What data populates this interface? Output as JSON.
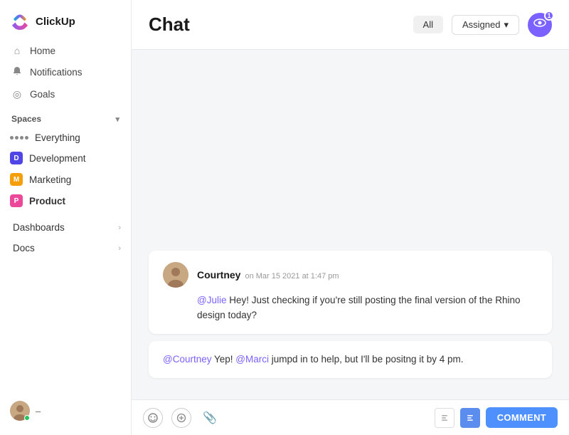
{
  "app": {
    "name": "ClickUp"
  },
  "sidebar": {
    "nav": [
      {
        "label": "Home",
        "icon": "🏠"
      },
      {
        "label": "Notifications",
        "icon": "🔔"
      },
      {
        "label": "Goals",
        "icon": "🎯"
      }
    ],
    "spaces_label": "Spaces",
    "spaces": [
      {
        "label": "Everything",
        "type": "everything"
      },
      {
        "label": "Development",
        "type": "badge",
        "badge_letter": "D",
        "badge_color": "#4f46e5"
      },
      {
        "label": "Marketing",
        "type": "badge",
        "badge_letter": "M",
        "badge_color": "#f59e0b"
      },
      {
        "label": "Product",
        "type": "badge",
        "badge_letter": "P",
        "badge_color": "#ec4899",
        "bold": true
      }
    ],
    "sections": [
      {
        "label": "Dashboards"
      },
      {
        "label": "Docs"
      }
    ]
  },
  "header": {
    "title": "Chat",
    "filter_all": "All",
    "filter_assigned": "Assigned",
    "notification_count": "1"
  },
  "messages": [
    {
      "author": "Courtney",
      "timestamp": "on Mar 15 2021 at 1:47 pm",
      "body_parts": [
        {
          "type": "mention",
          "text": "@Julie"
        },
        {
          "type": "text",
          "text": " Hey! Just checking if you're still posting the final version of the Rhino design today?"
        }
      ]
    }
  ],
  "reply": {
    "body_parts": [
      {
        "type": "mention",
        "text": "@Courtney"
      },
      {
        "type": "text",
        "text": " Yep! "
      },
      {
        "type": "mention",
        "text": "@Marci"
      },
      {
        "type": "text",
        "text": " jumpd in to help, but I'll be positng it by 4 pm."
      }
    ]
  },
  "input": {
    "comment_label": "COMMENT"
  }
}
